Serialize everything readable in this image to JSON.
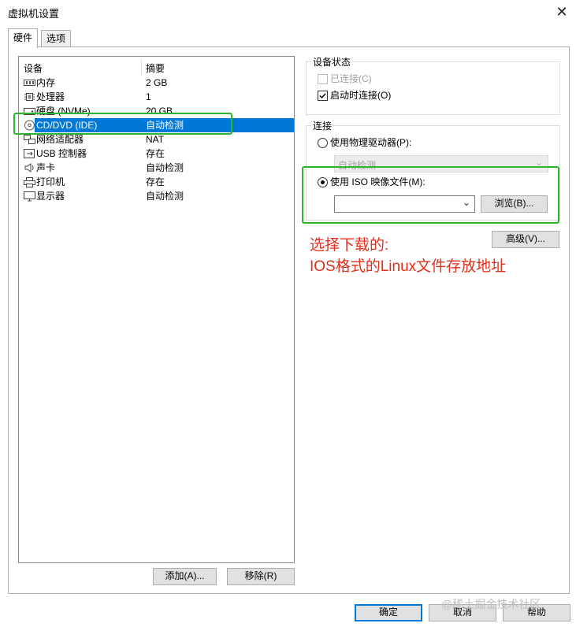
{
  "window": {
    "title": "虚拟机设置"
  },
  "tabs": [
    {
      "label": "硬件"
    },
    {
      "label": "选项"
    }
  ],
  "device_list": {
    "columns": [
      "设备",
      "摘要"
    ],
    "rows": [
      {
        "icon": "memory-icon",
        "name": "内存",
        "summary": "2 GB"
      },
      {
        "icon": "processor-icon",
        "name": "处理器",
        "summary": "1"
      },
      {
        "icon": "harddisk-icon",
        "name": "硬盘 (NVMe)",
        "summary": "20 GB"
      },
      {
        "icon": "cd-dvd-icon",
        "name": "CD/DVD (IDE)",
        "summary": "自动检测",
        "selected": true
      },
      {
        "icon": "network-adapter-icon",
        "name": "网络适配器",
        "summary": "NAT"
      },
      {
        "icon": "usb-icon",
        "name": "USB 控制器",
        "summary": "存在"
      },
      {
        "icon": "sound-card-icon",
        "name": "声卡",
        "summary": "自动检测"
      },
      {
        "icon": "printer-icon",
        "name": "打印机",
        "summary": "存在"
      },
      {
        "icon": "display-icon",
        "name": "显示器",
        "summary": "自动检测"
      }
    ],
    "add_label": "添加(A)...",
    "remove_label": "移除(R)"
  },
  "device_status": {
    "title": "设备状态",
    "connected": {
      "label": "已连接(C)",
      "checked": false,
      "enabled": false
    },
    "connect_at_power_on": {
      "label": "启动时连接(O)",
      "checked": true,
      "enabled": true
    }
  },
  "connection": {
    "title": "连接",
    "physical_drive": {
      "label": "使用物理驱动器(P):",
      "selected": false,
      "value": "自动检测"
    },
    "iso_image": {
      "label": "使用 ISO 映像文件(M):",
      "selected": true,
      "value": ""
    },
    "browse_label": "浏览(B)...",
    "advanced_label": "高级(V)..."
  },
  "annotation": "选择下载的:\nIOS格式的Linux文件存放地址",
  "footer": {
    "ok": "确定",
    "cancel": "取消",
    "help": "帮助"
  },
  "watermark": "@稀土掘金技术社区",
  "colors": {
    "selection": "#0078d7",
    "highlight_box": "#2db52d",
    "annotation": "#e0301e"
  }
}
